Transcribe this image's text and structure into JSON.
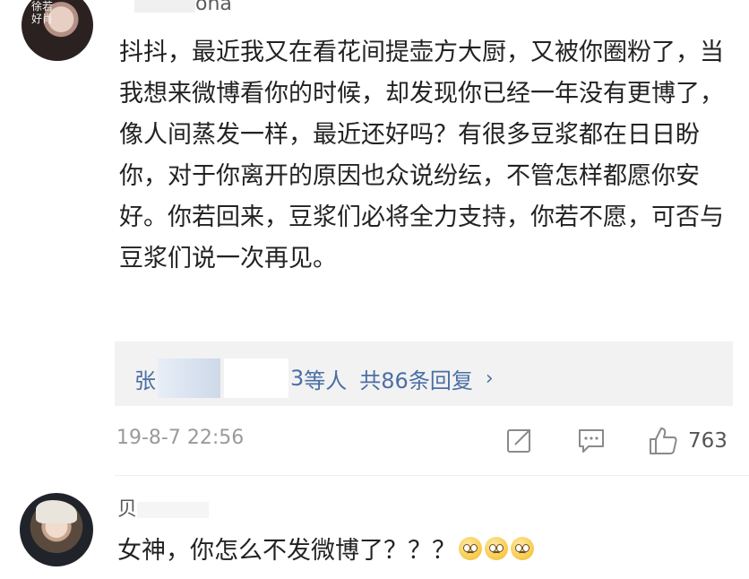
{
  "comment1": {
    "avatar_text": "徐若好肖",
    "username_suffix": "ona",
    "body": "抖抖，最近我又在看花间提壶方大厨，又被你圈粉了，当我想来微博看你的时候，却发现你已经一年没有更博了，像人间蒸发一样，最近还好吗？有很多豆浆都在日日盼你，对于你离开的原因也众说纷纭，不管怎样都愿你安好。你若回来，豆浆们必将全力支持，你若不愿，可否与豆浆们说一次再见。",
    "replies": {
      "name_start": "张",
      "name_end": "3",
      "and_others": "等人",
      "total_label": "共86条回复",
      "chevron": "›"
    },
    "timestamp": "19-8-7 22:56",
    "like_count": "763",
    "icons": [
      "share-icon",
      "comment-icon",
      "like-icon"
    ]
  },
  "comment2": {
    "username_prefix": "贝",
    "body": "女神，你怎么不发微博了？？？",
    "emoji_count": 3,
    "emoji_name": "sad-emoji"
  },
  "colors": {
    "link": "#4a6fa5",
    "meta": "#9a9a9a",
    "reply_bg": "#f2f2f2"
  }
}
